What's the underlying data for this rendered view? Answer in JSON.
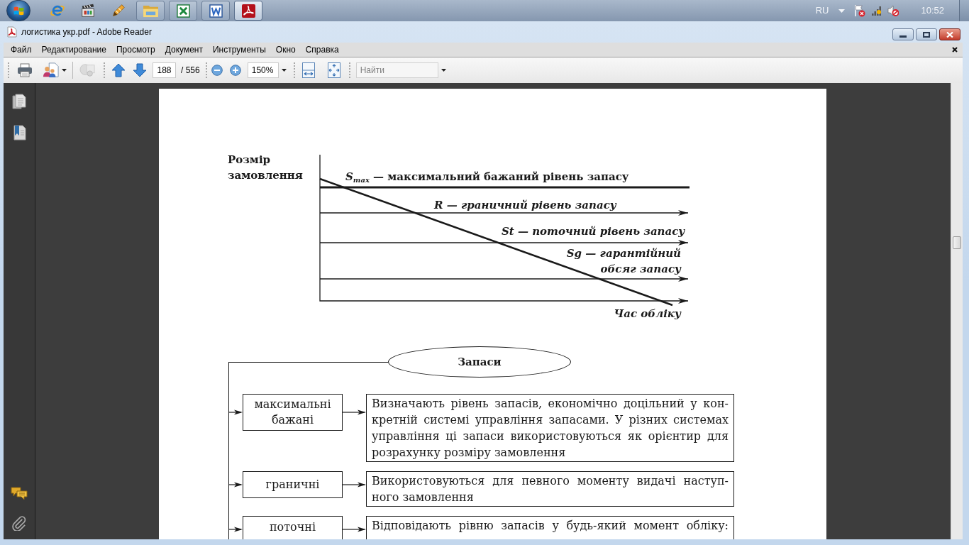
{
  "taskbar": {
    "apps": [
      {
        "kind": "folder",
        "selected": false
      },
      {
        "kind": "spreadsheet",
        "selected": false
      },
      {
        "kind": "document",
        "selected": false
      },
      {
        "kind": "pdf",
        "selected": true
      }
    ],
    "language": "RU",
    "clock": "10:52"
  },
  "window": {
    "title": "логистика укр.pdf - Adobe Reader"
  },
  "menu_bar": {
    "items": [
      "Файл",
      "Редактирование",
      "Просмотр",
      "Документ",
      "Инструменты",
      "Окно",
      "Справка"
    ]
  },
  "toolbar": {
    "page_field": {
      "value": "188"
    },
    "page_count": "/ 556",
    "zoom_field": {
      "value": "150%"
    },
    "search_field": {
      "placeholder": "Найти"
    }
  },
  "document": {
    "figure": {
      "y_axis_label": "Розмір замовлення",
      "levels": [
        {
          "kind": "max",
          "lines": [
            "*S*$_{max}$ — максимальний бажаний рівень запасу"
          ]
        },
        {
          "kind": "level",
          "lines": [
            "R — граничний рівень запасу"
          ]
        },
        {
          "kind": "level",
          "lines": [
            "St — поточний рівень запасу"
          ]
        },
        {
          "kind": "level",
          "lines": [
            "Sg — гарантійний",
            "обсяг запасу"
          ]
        }
      ],
      "x_axis_label": "Час обліку"
    },
    "flowchart": {
      "root": "Запаси",
      "rows": [
        {
          "category": "максимальні бажані",
          "description": [
            "Визначають рівень запасів, економічно доцільний у кон-",
            "кретній системі управління запасами. У різних системах",
            "управління ці запаси використовуються як орієнтир для",
            "розрахунку розміру замовлення"
          ]
        },
        {
          "category": "граничні",
          "description": [
            "Використовуються для певного моменту видачі наступ-",
            "ного замовлення"
          ]
        },
        {
          "category": "поточні",
          "description": [
            "Відповідають рівню запасів у будь-який момент обліку:"
          ]
        }
      ]
    }
  }
}
